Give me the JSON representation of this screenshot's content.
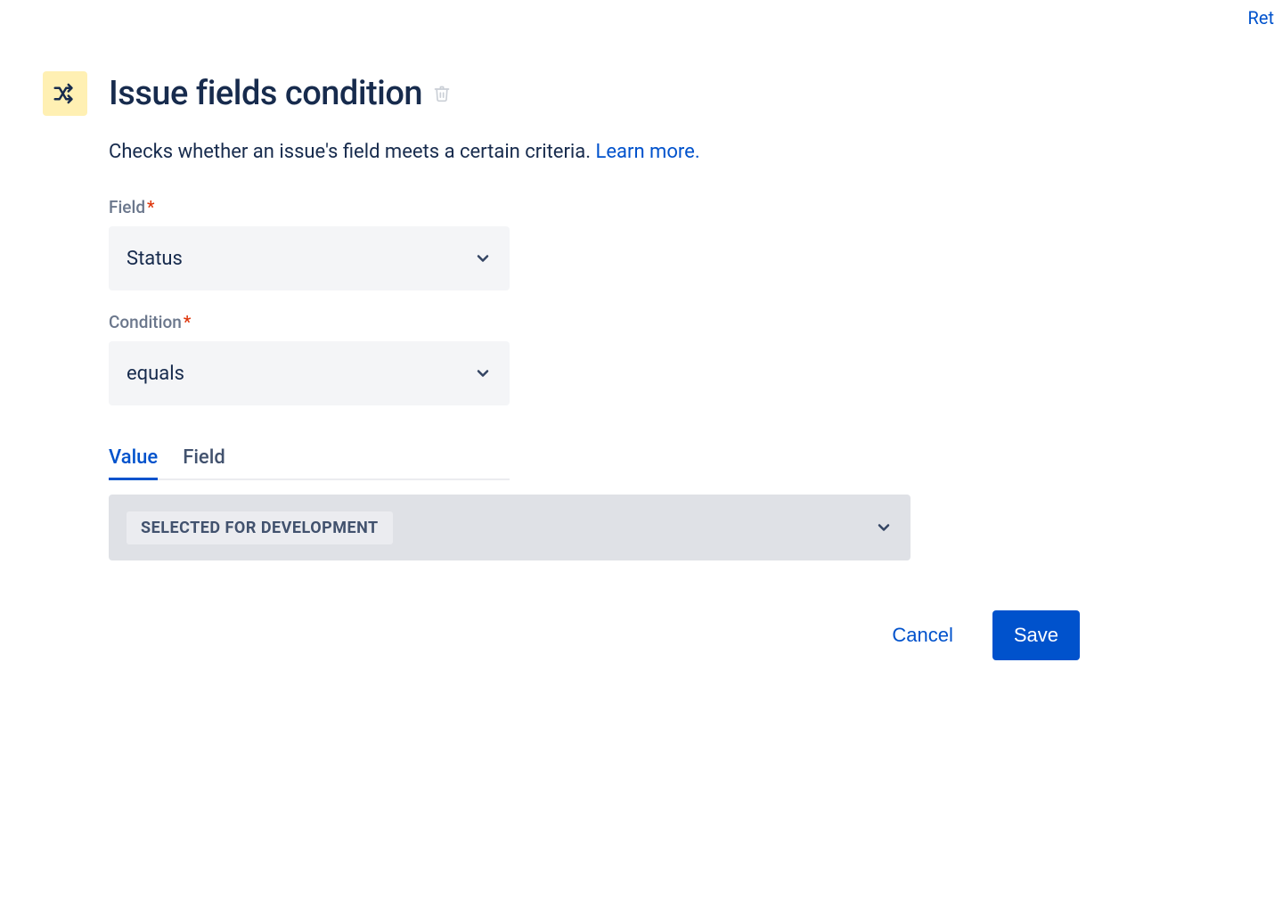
{
  "topLink": "Ret",
  "title": "Issue fields condition",
  "description": "Checks whether an issue's field meets a certain criteria.",
  "learnMore": "Learn more.",
  "fields": {
    "field": {
      "label": "Field",
      "value": "Status"
    },
    "condition": {
      "label": "Condition",
      "value": "equals"
    }
  },
  "tabs": {
    "value": "Value",
    "field": "Field"
  },
  "selectedValue": "SELECTED FOR DEVELOPMENT",
  "actions": {
    "cancel": "Cancel",
    "save": "Save"
  }
}
